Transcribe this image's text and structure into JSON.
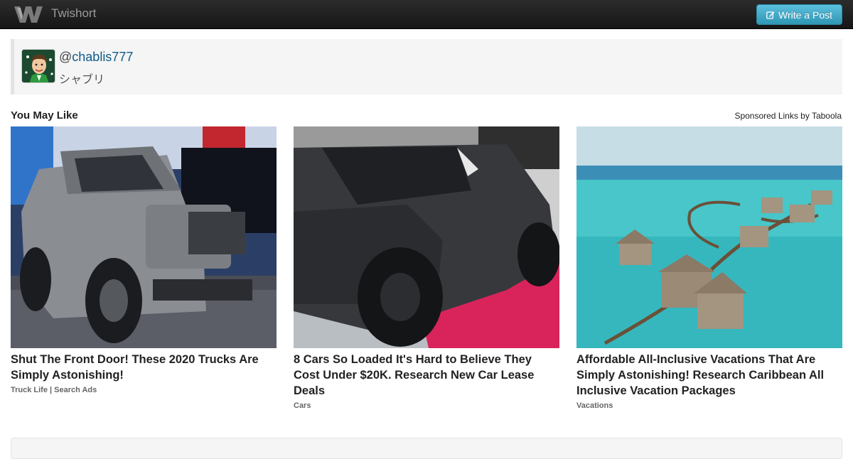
{
  "navbar": {
    "brand": "Twishort",
    "write_button": "Write a Post"
  },
  "profile": {
    "at": "@",
    "handle": "chablis777",
    "display_name": "シャブリ"
  },
  "recommendations": {
    "title": "You May Like",
    "sponsored": "Sponsored Links by Taboola",
    "items": [
      {
        "headline": "Shut The Front Door! These 2020 Trucks Are Simply Astonishing!",
        "source": "Truck Life | Search Ads"
      },
      {
        "headline": "8 Cars So Loaded It's Hard to Believe They Cost Under $20K. Research New Car Lease Deals",
        "source": "Cars"
      },
      {
        "headline": "Affordable All-Inclusive Vacations That Are Simply Astonishing! Research Caribbean All Inclusive Vacation Packages",
        "source": "Vacations"
      }
    ]
  },
  "colors": {
    "navbar": "#1e1e1e",
    "button": "#49afcd",
    "link": "#0e5a8a"
  }
}
